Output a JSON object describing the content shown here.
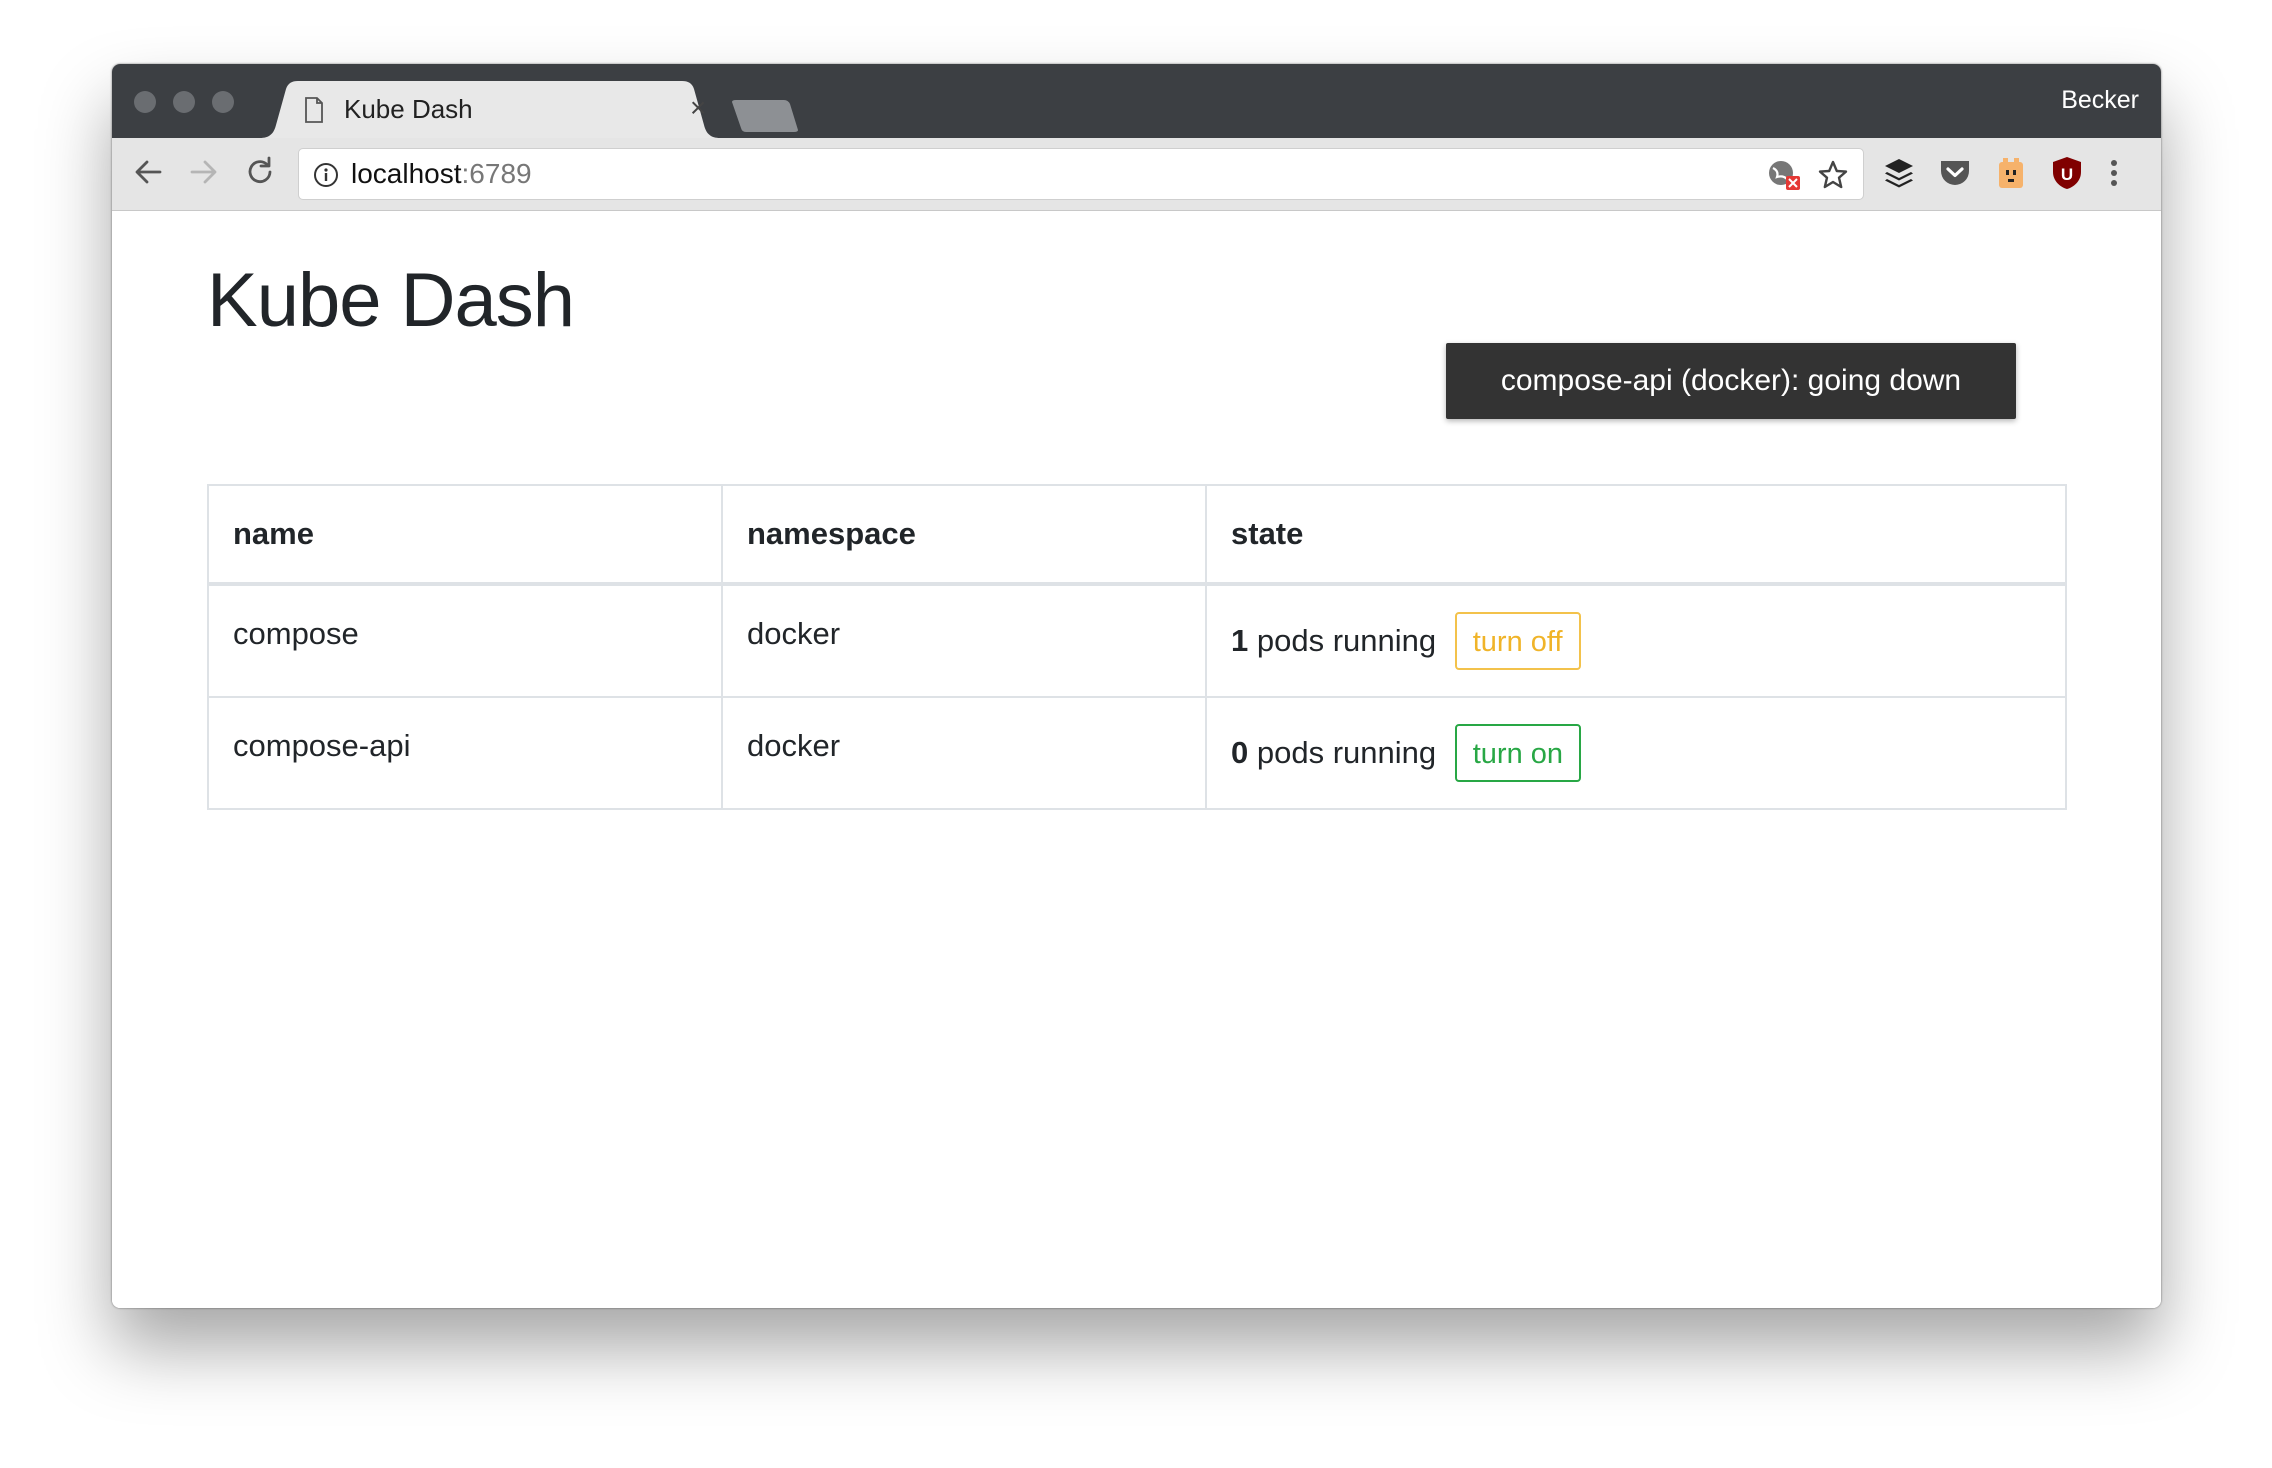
{
  "browser": {
    "tab_title": "Kube Dash",
    "tab_close": "×",
    "profile_name": "Becker",
    "url_host": "localhost",
    "url_port": ":6789"
  },
  "page": {
    "title": "Kube Dash",
    "toast": "compose-api (docker): going down"
  },
  "table": {
    "headers": {
      "name": "name",
      "namespace": "namespace",
      "state": "state"
    },
    "rows": [
      {
        "name": "compose",
        "namespace": "docker",
        "pods_count": "1",
        "pods_label": " pods running",
        "action": "turn off"
      },
      {
        "name": "compose-api",
        "namespace": "docker",
        "pods_count": "0",
        "pods_label": " pods running",
        "action": "turn on"
      }
    ]
  },
  "colors": {
    "turn_off": "#f0b429",
    "turn_on": "#28a745",
    "toast_bg": "#333333",
    "tabstrip_bg": "#3c3f43"
  },
  "icons": {
    "traffic_lights": [
      "close-dot",
      "minimize-dot",
      "zoom-dot"
    ],
    "toolbar": [
      "back-arrow-icon",
      "forward-arrow-icon",
      "reload-icon"
    ],
    "omnibox": [
      "info-icon",
      "translate-blocked-icon",
      "star-icon"
    ],
    "extensions": [
      "buffer-stack-icon",
      "pocket-icon",
      "honey-extension-icon",
      "ublock-icon",
      "menu-dots-icon"
    ]
  }
}
